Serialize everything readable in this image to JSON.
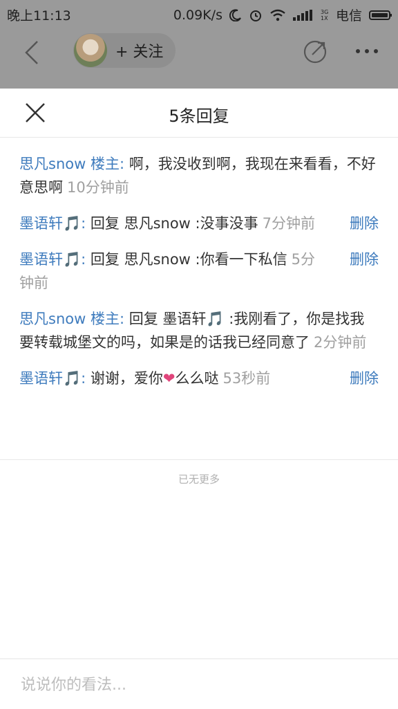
{
  "status_bar": {
    "time": "晚上11:13",
    "speed": "0.09K/s",
    "network_label": "3G 1X",
    "carrier": "电信"
  },
  "top_bar": {
    "follow_label": "+ 关注",
    "icons": [
      "back-icon",
      "share-icon",
      "more-icon"
    ]
  },
  "sheet": {
    "title": "5条回复",
    "replies": [
      {
        "author": "思凡snow 楼主",
        "colon": ":",
        "content": " 啊，我没收到啊，我现在来看看，不好意思啊",
        "time": "10分钟前",
        "delete": ""
      },
      {
        "author": "墨语轩🎵",
        "colon": ":",
        "content": " 回复 思凡snow :没事没事",
        "time": "7分钟前",
        "delete": "删除"
      },
      {
        "author": "墨语轩🎵",
        "colon": ":",
        "content": " 回复 思凡snow :你看一下私信",
        "time": "5分钟前",
        "delete": "删除"
      },
      {
        "author": "思凡snow 楼主",
        "colon": ":",
        "content": " 回复 墨语轩🎵 :我刚看了，你是找我要转载城堡文的吗，如果是的话我已经同意了",
        "time": "2分钟前",
        "delete": ""
      },
      {
        "author": "墨语轩🎵",
        "colon": ":",
        "content_before": " 谢谢，爱你",
        "heart": "❤",
        "content_after": "么么哒",
        "time": "53秒前",
        "delete": "删除"
      }
    ],
    "no_more": "已无更多",
    "input_placeholder": "说说你的看法..."
  },
  "colors": {
    "accent": "#3e7bbd",
    "overlay": "#9a9a9a",
    "heart": "#e0457b"
  }
}
